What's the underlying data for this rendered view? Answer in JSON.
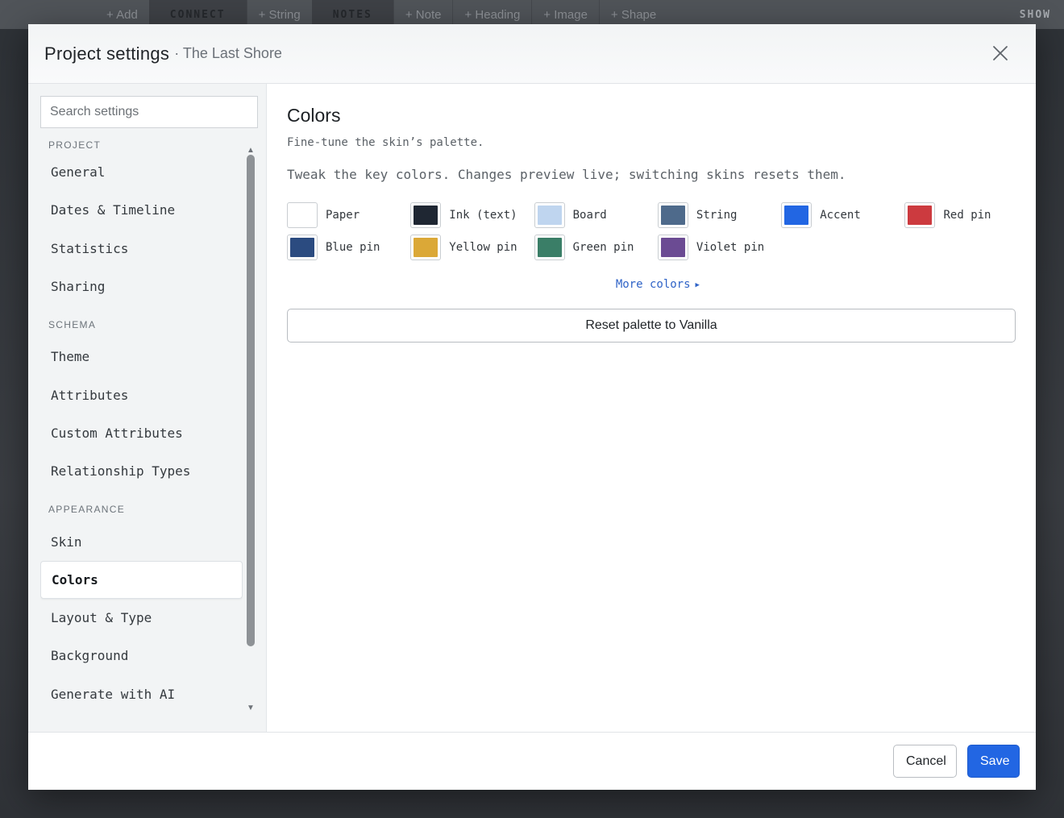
{
  "app_toolbar": {
    "add": "+ Add",
    "connect": "CONNECT",
    "string": "+ String",
    "notes": "NOTES",
    "note": "+ Note",
    "heading": "+ Heading",
    "image": "+ Image",
    "shape": "+ Shape",
    "show": "SHOW"
  },
  "modal": {
    "title": "Project settings",
    "subtitle": "· The Last Shore",
    "close_icon": "close-icon"
  },
  "sidebar": {
    "search_placeholder": "Search settings",
    "sections": [
      {
        "label": "PROJECT",
        "items": [
          "General",
          "Dates & Timeline",
          "Statistics",
          "Sharing"
        ]
      },
      {
        "label": "SCHEMA",
        "items": [
          "Theme",
          "Attributes",
          "Custom Attributes",
          "Relationship Types"
        ]
      },
      {
        "label": "APPEARANCE",
        "items": [
          "Skin",
          "Colors",
          "Layout & Type",
          "Background",
          "Generate with AI"
        ]
      }
    ],
    "active_item": "Colors"
  },
  "content": {
    "title": "Colors",
    "description": "Fine-tune the skin’s palette.",
    "note": "Tweak the key colors. Changes preview live; switching skins resets them.",
    "swatches": [
      {
        "label": "Paper",
        "color": "#ffffff"
      },
      {
        "label": "Ink (text)",
        "color": "#1f2733"
      },
      {
        "label": "Board",
        "color": "#bfd5ef"
      },
      {
        "label": "String",
        "color": "#4e6a8b"
      },
      {
        "label": "Accent",
        "color": "#2266e3"
      },
      {
        "label": "Red pin",
        "color": "#cc3a3f"
      },
      {
        "label": "Blue pin",
        "color": "#2b4b80"
      },
      {
        "label": "Yellow pin",
        "color": "#dba837"
      },
      {
        "label": "Green pin",
        "color": "#3a7e67"
      },
      {
        "label": "Violet pin",
        "color": "#6b4b93"
      }
    ],
    "more_colors": "More colors",
    "reset_button": "Reset palette to Vanilla"
  },
  "footer": {
    "cancel": "Cancel",
    "save": "Save"
  },
  "colors": {
    "accent": "#2266e3",
    "link": "#2f63c7"
  }
}
